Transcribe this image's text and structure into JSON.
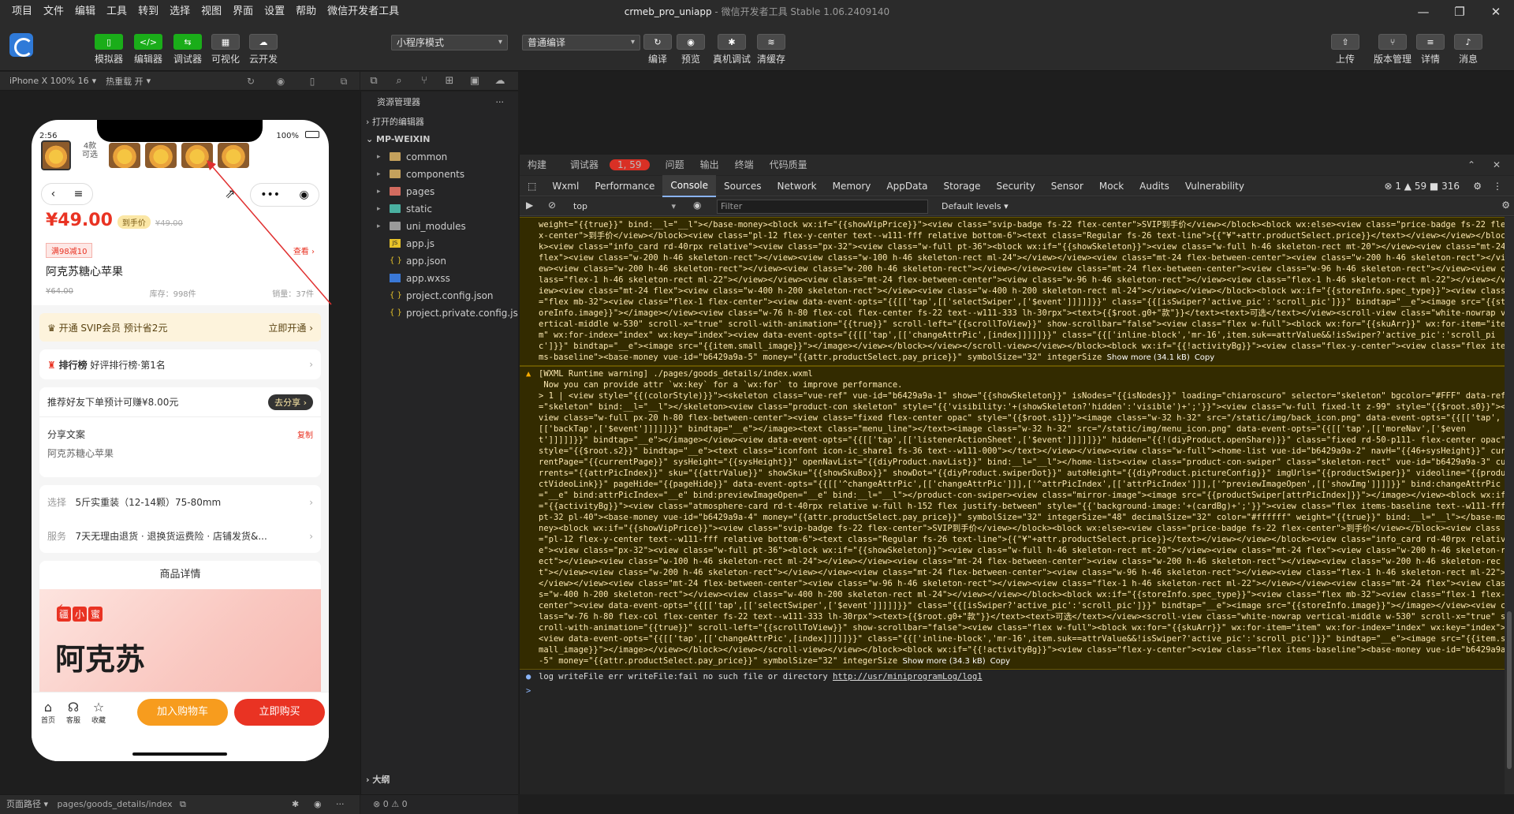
{
  "menu": [
    "项目",
    "文件",
    "编辑",
    "工具",
    "转到",
    "选择",
    "视图",
    "界面",
    "设置",
    "帮助",
    "微信开发者工具"
  ],
  "window": {
    "project": "crmeb_pro_uniapp",
    "app": "微信开发者工具 Stable 1.06.2409140"
  },
  "toolbar": {
    "left_buttons": [
      "模拟器",
      "编辑器",
      "调试器",
      "可视化",
      "云开发"
    ],
    "mode_select": "小程序模式",
    "compile_select": "普通编译",
    "mid_buttons": [
      "编译",
      "预览",
      "真机调试",
      "清缓存"
    ],
    "right_buttons": [
      "上传",
      "版本管理",
      "详情",
      "消息"
    ]
  },
  "simulator": {
    "device": "iPhone X 100% 16",
    "hotreload": "热重载 开",
    "status_time": "2:56",
    "status_battery": "100%",
    "swiper_count": "4款\n可选",
    "price": "¥49.00",
    "price_tag": "到手价",
    "price_old": "¥49.00",
    "coupon": "满98减10",
    "lookmore": "查看 ›",
    "product_name": "阿克苏糖心苹果",
    "old_price2": "¥64.00",
    "stock": "库存：998件",
    "sales": "销量：37件",
    "svip_text": "开通 SVIP会员 预计省2元",
    "svip_action": "立即开通 ›",
    "rank_title": "排行榜",
    "rank_text": "好评排行榜·第1名",
    "share_text": "推荐好友下单预计可赚¥8.00元",
    "share_button": "去分享 ›",
    "copy_title": "分享文案",
    "copy_action": "复制",
    "copy_text": "阿克苏糖心苹果",
    "select_label": "选择",
    "select_value": "5斤实重装（12-14颗）75-80mm",
    "service_label": "服务",
    "service_value": "7天无理由退货 · 退换货运费险 · 店铺发货&...",
    "detail_title": "商品详情",
    "banner_stamp": [
      "疆",
      "小",
      "蜜"
    ],
    "banner_big": "阿克苏",
    "tabbar": [
      "首页",
      "客服",
      "收藏"
    ],
    "add_cart": "加入购物车",
    "buy_now": "立即购买"
  },
  "explorer": {
    "title": "资源管理器",
    "open_editors": "打开的编辑器",
    "root": "MP-WEIXIN",
    "items": [
      {
        "name": "common",
        "type": "folder",
        "color": "#c5a15c"
      },
      {
        "name": "components",
        "type": "folder",
        "color": "#c5a15c"
      },
      {
        "name": "pages",
        "type": "folder",
        "color": "#d36b5f"
      },
      {
        "name": "static",
        "type": "folder",
        "color": "#4ab0a0"
      },
      {
        "name": "uni_modules",
        "type": "folder",
        "color": "#9a9a9a"
      },
      {
        "name": "app.js",
        "type": "js"
      },
      {
        "name": "app.json",
        "type": "json"
      },
      {
        "name": "app.wxss",
        "type": "wxss"
      },
      {
        "name": "project.config.json",
        "type": "json"
      },
      {
        "name": "project.private.config.js...",
        "type": "json"
      }
    ],
    "outline": "大纲",
    "problems": "⊗ 0 ⚠ 0"
  },
  "debugger": {
    "top_tabs": [
      "构建",
      "调试器",
      "问题",
      "输出",
      "终端",
      "代码质量"
    ],
    "badge": "1, 59",
    "tabs": [
      "Wxml",
      "Performance",
      "Console",
      "Sources",
      "Network",
      "Memory",
      "AppData",
      "Storage",
      "Security",
      "Sensor",
      "Mock",
      "Audits",
      "Vulnerability"
    ],
    "counts": "⊗ 1 ▲ 59 ■ 316",
    "context": "top",
    "filter_placeholder": "Filter",
    "levels": "Default levels ▾",
    "warn1": "weight=\"{{true}}\" bind:__l=\"__l\"></base-money><block wx:if=\"{{showVipPrice}}\"><view class=\"svip-badge fs-22 flex-center\">SVIP到手价</view></block><block wx:else><view class=\"price-badge fs-22 flex-center\">到手价</view></block><view class=\"pl-12 flex-y-center text--w111-fff relative bottom-6\"><text class=\"Regular fs-26 text-line\">{{\"¥\"+attr.productSelect.price}}</text></view></view></block><view class=\"info_card rd-40rpx relative\"><view class=\"px-32\"><view class=\"w-full pt-36\"><block wx:if=\"{{showSkeleton}}\"><view class=\"w-full h-46 skeleton-rect mt-20\"></view><view class=\"mt-24 flex\"><view class=\"w-200 h-46 skeleton-rect\"></view><view class=\"w-100 h-46 skeleton-rect ml-24\"></view></view><view class=\"mt-24 flex-between-center\"><view class=\"w-200 h-46 skeleton-rect\"></view><view class=\"w-200 h-46 skeleton-rect\"></view><view class=\"w-200 h-46 skeleton-rect\"></view></view><view class=\"mt-24 flex-between-center\"><view class=\"w-96 h-46 skeleton-rect\"></view><view class=\"flex-1 h-46 skeleton-rect ml-22\"></view></view><view class=\"mt-24 flex-between-center\"><view class=\"w-96 h-46 skeleton-rect\"></view><view class=\"flex-1 h-46 skeleton-rect ml-22\"></view></view><view class=\"mt-24 flex\"><view class=\"w-400 h-200 skeleton-rect\"></view><view class=\"w-400 h-200 skeleton-rect ml-24\"></view></view></block><block wx:if=\"{{storeInfo.spec_type}}\"><view class=\"flex mb-32\"><view class=\"flex-1 flex-center\"><view data-event-opts=\"{{[['tap',[['selectSwiper',['$event']]]]]}}\" class=\"{{[isSwiper?'active_pic':'scroll_pic']}}\" bindtap=\"__e\"><image src=\"{{storeInfo.image}}\"></image></view><view class=\"w-76 h-80 flex-col flex-center fs-22 text--w111-333 lh-30rpx\"><text>{{$root.g0+\"款\"}}</text><text>可选</text></view><scroll-view class=\"white-nowrap vertical-middle w-530\" scroll-x=\"true\" scroll-with-animation=\"{{true}}\" scroll-left=\"{{scrollToView}}\" show-scrollbar=\"false\"><view class=\"flex w-full\"><block wx:for=\"{{skuArr}}\" wx:for-item=\"item\" wx:for-index=\"index\" wx:key=\"index\"><view data-event-opts=\"{{[['tap',[['changeAttrPic',[index]]]]]}}\" class=\"{{['inline-block','mr-16',item.suk==attrValue&&!isSwiper?'active_pic':'scroll_pic']}}\" bindtap=\"__e\"><image src=\"{{item.small_image}}\"></image></view></block></view></scroll-view></view></block><block wx:if=\"{{!activityBg}}\"><view class=\"flex-y-center\"><view class=\"flex items-baseline\"><base-money vue-id=\"b6429a9a-5\" money=\"{{attr.productSelect.pay_price}}\" symbolSize=\"32\" integerSize",
    "showmore1": "Show more (34.1 kB)",
    "copy": "Copy",
    "warn2_head": "[WXML Runtime warning] ./pages/goods_details/index.wxml\n Now you can provide attr `wx:key` for a `wx:for` to improve performance.",
    "warn2": "> 1 | <view style=\"{{(colorStyle)}}\"><skeleton class=\"vue-ref\" vue-id=\"b6429a9a-1\" show=\"{{showSkeleton}}\" isNodes=\"{{isNodes}}\" loading=\"chiaroscuro\" selector=\"skeleton\" bgcolor=\"#FFF\" data-ref=\"skeleton\" bind:__l=\"__l\"></skeleton><view class=\"product-con skeleton\" style=\"{{'visibility:'+(showSkeleton?'hidden':'visible')+';'}}\"><view class=\"w-full fixed-lt z-99\" style=\"{{$root.s0}}\"><view class=\"w-full px-20 h-80 flex-between-center\"><view class=\"fixed flex-center opac\" style=\"{{$root.s1}}\"><image class=\"w-32 h-32\" src=\"/static/img/back_icon.png\" data-event-opts=\"{{[['tap',[['backTap',['$event']]]]]}}\" bindtap=\"__e\"></image><text class=\"menu_line\"></text><image class=\"w-32 h-32\" src=\"/static/img/menu_icon.png\" data-event-opts=\"{{[['tap',[['moreNav',['$event']]]]]}}\" bindtap=\"__e\"></image></view><view data-event-opts=\"{{[['tap',[['listenerActionSheet',['$event']]]]]}}\" hidden=\"{{!(diyProduct.openShare)}}\" class=\"fixed rd-50-p111- flex-center opac\" style=\"{{$root.s2}}\" bindtap=\"__e\"><text class=\"iconfont icon-ic_share1 fs-36 text--w111-000\"></text></view></view><view class=\"w-full\"><home-list vue-id=\"b6429a9a-2\" navH=\"{{46+sysHeight}}\" currentPage=\"{{currentPage}}\" sysHeight=\"{{sysHeight}}\" openNavList=\"{{diyProduct.navList}}\" bind:__l=\"__l\"></home-list><view class=\"product-con-swiper\" class=\"skeleton-rect\" vue-id=\"b6429a9a-3\" currents=\"{{attrPicIndex}}\" sku=\"{{attrValue}}\" showSku=\"{{showSkuBox}}\" showDot=\"{{diyProduct.swiperDot}}\" autoHeight=\"{{diyProduct.pictureConfig}}\" imgUrls=\"{{productSwiper}}\" videoline=\"{{productVideoLink}}\" pageHide=\"{{pageHide}}\" data-event-opts=\"{{[['^changeAttrPic',[['changeAttrPic']]],['^attrPicIndex',[['attrPicIndex']]],['^previewImageOpen',[['showImg']]]]}}\" bind:changeAttrPic=\"__e\" bind:attrPicIndex=\"__e\" bind:previewImageOpen=\"__e\" bind:__l=\"__l\"></product-con-swiper><view class=\"mirror-image\"><image src=\"{{productSwiper[attrPicIndex]}}\"></image></view><block wx:if=\"{{activityBg}}\"><view class=\"atmosphere-card rd-t-40rpx relative w-full h-152 flex justify-between\" style=\"{{'background-image:'+(cardBg)+';'}}\"><view class=\"flex items-baseline text--w111-fff pt-32 pl-40\"><base-money vue-id=\"b6429a9a-4\" money=\"{{attr.productSelect.pay_price}}\" symbolSize=\"32\" integerSize=\"48\" decimalSize=\"32\" color=\"#ffffff\" weight=\"{{true}}\" bind:__l=\"__l\"></base-money><block wx:if=\"{{showVipPrice}}\"><view class=\"svip-badge fs-22 flex-center\">SVIP到手价</view></block><block wx:else><view class=\"price-badge fs-22 flex-center\">到手价</view></block><view class=\"pl-12 flex-y-center text--w111-fff relative bottom-6\"><text class=\"Regular fs-26 text-line\">{{\"¥\"+attr.productSelect.price}}</text></view></view></block><view class=\"info_card rd-40rpx relative\"><view class=\"px-32\"><view class=\"w-full pt-36\"><block wx:if=\"{{showSkeleton}}\"><view class=\"w-full h-46 skeleton-rect mt-20\"></view><view class=\"mt-24 flex\"><view class=\"w-200 h-46 skeleton-rect\"></view><view class=\"w-100 h-46 skeleton-rect ml-24\"></view></view><view class=\"mt-24 flex-between-center\"><view class=\"w-200 h-46 skeleton-rect\"></view><view class=\"w-200 h-46 skeleton-rect\"></view><view class=\"w-200 h-46 skeleton-rect\"></view></view><view class=\"mt-24 flex-between-center\"><view class=\"w-96 h-46 skeleton-rect\"></view><view class=\"flex-1 h-46 skeleton-rect ml-22\"></view></view><view class=\"mt-24 flex-between-center\"><view class=\"w-96 h-46 skeleton-rect\"></view><view class=\"flex-1 h-46 skeleton-rect ml-22\"></view></view><view class=\"mt-24 flex\"><view class=\"w-400 h-200 skeleton-rect\"></view><view class=\"w-400 h-200 skeleton-rect ml-24\"></view></view></block><block wx:if=\"{{storeInfo.spec_type}}\"><view class=\"flex mb-32\"><view class=\"flex-1 flex-center\"><view data-event-opts=\"{{[['tap',[['selectSwiper',['$event']]]]]}}\" class=\"{{[isSwiper?'active_pic':'scroll_pic']}}\" bindtap=\"__e\"><image src=\"{{storeInfo.image}}\"></image></view><view class=\"w-76 h-80 flex-col flex-center fs-22 text--w111-333 lh-30rpx\"><text>{{$root.g0+\"款\"}}</text><text>可选</text></view><scroll-view class=\"white-nowrap vertical-middle w-530\" scroll-x=\"true\" scroll-with-animation=\"{{true}}\" scroll-left=\"{{scrollToView}}\" show-scrollbar=\"false\"><view class=\"flex w-full\"><block wx:for=\"{{skuArr}}\" wx:for-item=\"item\" wx:for-index=\"index\" wx:key=\"index\"><view data-event-opts=\"{{[['tap',[['changeAttrPic',[index]]]]]}}\" class=\"{{['inline-block','mr-16',item.suk==attrValue&&!isSwiper?'active_pic':'scroll_pic']}}\" bindtap=\"__e\"><image src=\"{{item.small_image}}\"></image></view></block></view></scroll-view></view></block><block wx:if=\"{{!activityBg}}\"><view class=\"flex-y-center\"><view class=\"flex items-baseline\"><base-money vue-id=\"b6429a9a-5\" money=\"{{attr.productSelect.pay_price}}\" symbolSize=\"32\" integerSize",
    "showmore2": "Show more (34.3 kB)",
    "log_text": "log writeFile err writeFile:fail no such file or directory ",
    "log_link": "http://usr/miniprogramLog/log1",
    "prompt": ">"
  },
  "statusbar": {
    "label": "页面路径 ▾",
    "path": "pages/goods_details/index"
  }
}
